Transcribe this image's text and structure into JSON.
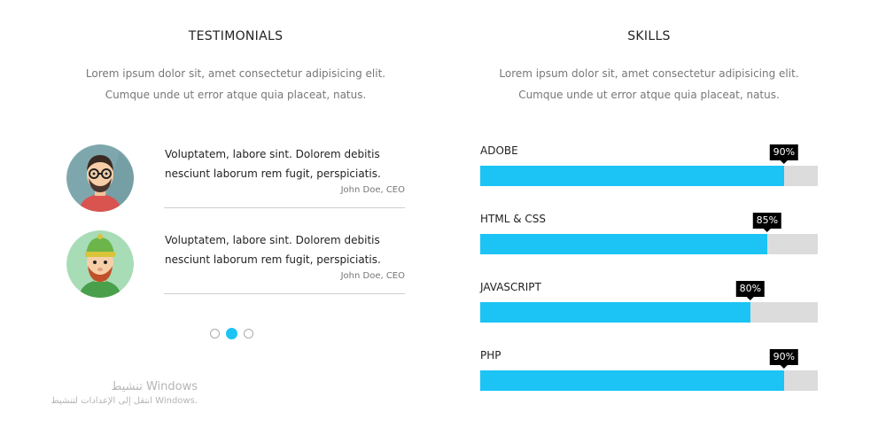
{
  "testimonials": {
    "title": "TESTIMONIALS",
    "description": "Lorem ipsum dolor sit, amet consectetur adipisicing elit. Cumque unde ut error atque quia placeat, natus.",
    "items": [
      {
        "quote": "Voluptatem, labore sint. Dolorem debitis nesciunt laborum rem fugit, perspiciatis.",
        "author": "John Doe, CEO",
        "avatar_icon": "man-glasses-avatar-icon"
      },
      {
        "quote": "Voluptatem, labore sint. Dolorem debitis nesciunt laborum rem fugit, perspiciatis.",
        "author": "John Doe, CEO",
        "avatar_icon": "man-beanie-avatar-icon"
      }
    ],
    "carousel": {
      "count": 3,
      "active_index": 1
    }
  },
  "skills": {
    "title": "SKILLS",
    "description": "Lorem ipsum dolor sit, amet consectetur adipisicing elit. Cumque unde ut error atque quia placeat, natus.",
    "items": [
      {
        "label": "ADOBE",
        "percent": 90,
        "percent_label": "90%"
      },
      {
        "label": "HTML & CSS",
        "percent": 85,
        "percent_label": "85%"
      },
      {
        "label": "JAVASCRIPT",
        "percent": 80,
        "percent_label": "80%"
      },
      {
        "label": "PHP",
        "percent": 90,
        "percent_label": "90%"
      }
    ]
  },
  "watermark": {
    "title": "تنشيط Windows",
    "subtitle": "انتقل إلى الإعدادات لتنشيط Windows."
  },
  "colors": {
    "accent": "#1bc4f5",
    "bar_track": "#dcdcdc",
    "bubble": "#000000"
  }
}
